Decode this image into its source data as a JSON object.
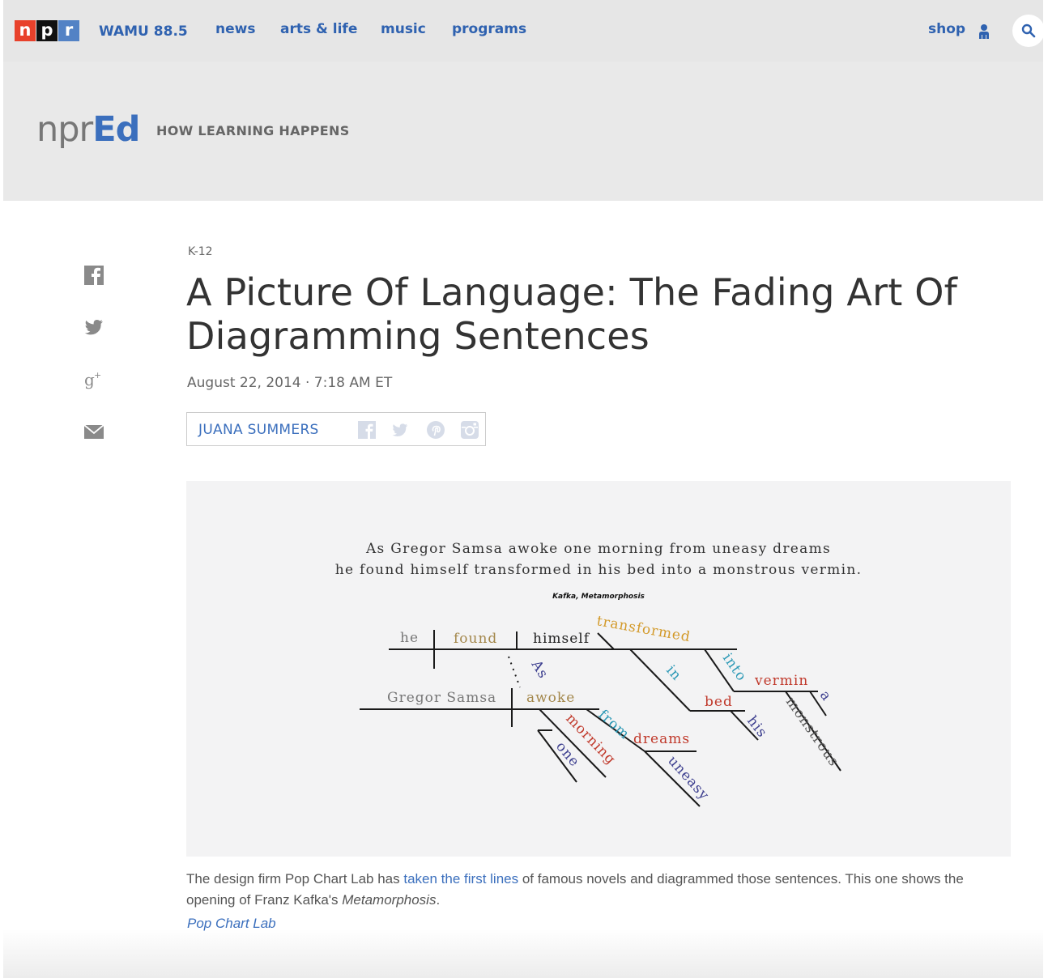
{
  "nav": {
    "logo_letters": [
      "n",
      "p",
      "r"
    ],
    "station": "WAMU 88.5",
    "items": [
      "news",
      "arts & life",
      "music",
      "programs"
    ],
    "shop": "shop",
    "brand_colors": {
      "n": "#e8412b",
      "p": "#111111",
      "r": "#5382c5",
      "link": "#2f62b0"
    }
  },
  "brand": {
    "logo_npr": "npr",
    "logo_ed": "Ed",
    "tagline": "HOW LEARNING HAPPENS"
  },
  "share": {
    "icons": [
      "facebook-icon",
      "twitter-icon",
      "google-plus-icon",
      "email-icon"
    ]
  },
  "article": {
    "slug": "K-12",
    "title": "A Picture Of Language: The Fading Art Of Diagramming Sentences",
    "date": "August 22, 2014 · 7:18 AM ET",
    "author": "JUANA SUMMERS",
    "author_social_icons": [
      "facebook-icon",
      "twitter-icon",
      "pinterest-icon",
      "instagram-icon"
    ]
  },
  "figure": {
    "quote_line1": "As Gregor Samsa awoke one morning from uneasy dreams",
    "quote_line2": "he found himself transformed in his bed into a monstrous vermin.",
    "source": "Kafka, Metamorphosis",
    "words": {
      "he": "he",
      "found": "found",
      "himself": "himself",
      "transformed": "transformed",
      "as": "As",
      "in": "in",
      "into": "into",
      "vermin": "vermin",
      "bed": "bed",
      "his": "his",
      "a": "a",
      "monstrous": "monstrous",
      "gregor_samsa": "Gregor Samsa",
      "awoke": "awoke",
      "morning": "morning",
      "one": "one",
      "from": "from",
      "dreams": "dreams",
      "uneasy": "uneasy"
    },
    "word_colors": {
      "subject": "#777777",
      "verb": "#a3874b",
      "object": "#222222",
      "modifier": "#d39a2a",
      "preposition": "#2a98b5",
      "noun": "#c0392b",
      "article": "#3d3f8f",
      "adjective": "#555555"
    },
    "caption_before": "The design firm Pop Chart Lab has ",
    "caption_link": "taken the first lines",
    "caption_after": " of famous novels and diagrammed those sentences. This one shows the opening of Franz Kafka's ",
    "caption_italic": "Metamorphosis",
    "caption_end": ".",
    "credit": "Pop Chart Lab"
  }
}
